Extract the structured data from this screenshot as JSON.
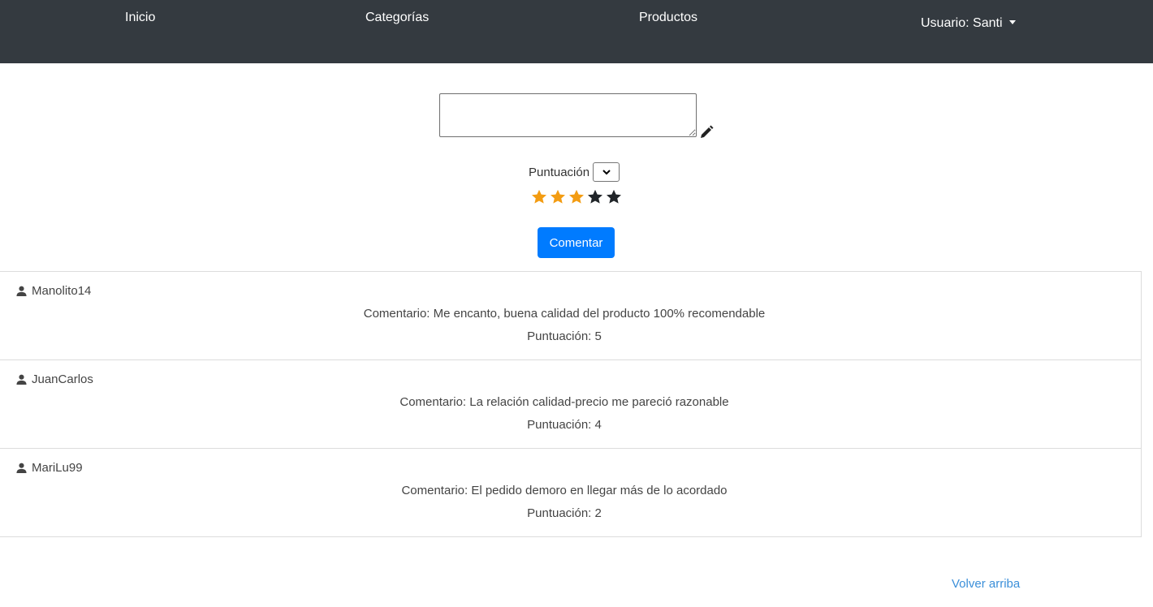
{
  "nav": {
    "items": [
      {
        "label": "Inicio"
      },
      {
        "label": "Categorías"
      },
      {
        "label": "Productos"
      }
    ],
    "user_label": "Usuario: Santi"
  },
  "form": {
    "comment_value": "",
    "edit_icon": "pencil-icon",
    "score_label": "Puntuación",
    "score_selected": "",
    "rating": {
      "value": 3,
      "max": 5,
      "filled_color": "#f39c12",
      "empty_color": "#212529"
    },
    "submit_label": "Comentar",
    "submit_color": "#007bff"
  },
  "comments": [
    {
      "user": "Manolito14",
      "text": "Comentario: Me encanto, buena calidad del producto 100% recomendable",
      "score": "Puntuación: 5"
    },
    {
      "user": "JuanCarlos",
      "text": "Comentario: La relación calidad-precio me pareció razonable",
      "score": "Puntuación: 4"
    },
    {
      "user": "MariLu99",
      "text": "Comentario: El pedido demoro en llegar más de lo acordado",
      "score": "Puntuación: 2"
    }
  ],
  "footer": {
    "back_to_top": "Volver arriba",
    "link_color": "#3b8fd9"
  }
}
